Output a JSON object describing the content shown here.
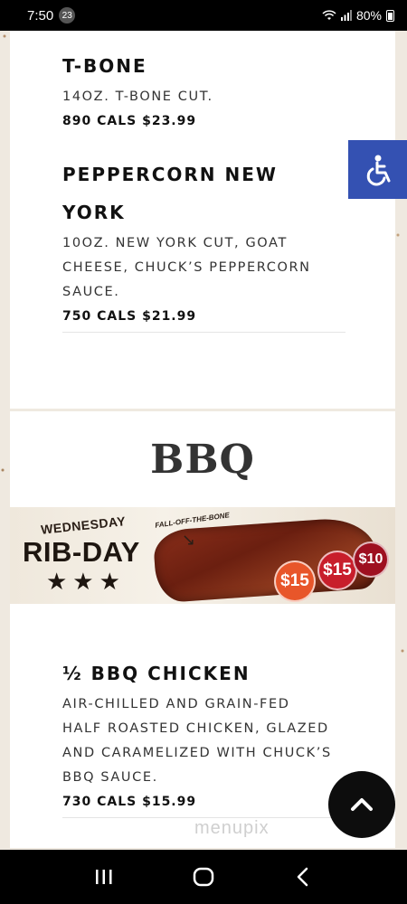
{
  "status_bar": {
    "time": "7:50",
    "notification_count": "23",
    "battery": "80%"
  },
  "menu_items_top": [
    {
      "name": "T-BONE",
      "description": "14OZ. T-BONE CUT.",
      "price": "890 CALS $23.99"
    },
    {
      "name_line1": "PEPPERCORN NEW",
      "name_line2": "YORK",
      "description_lines": [
        "10OZ. NEW YORK CUT, GOAT",
        "CHEESE, CHUCK’S PEPPERCORN",
        "SAUCE."
      ],
      "price": "750 CALS $21.99"
    }
  ],
  "section": {
    "title": "BBQ"
  },
  "banner": {
    "day": "WEDNESDAY",
    "title": "RIB-DAY",
    "stars": "★★★",
    "tagline": "FALL-OFF-THE-BONE",
    "badges": [
      "$15",
      "$15",
      "$10"
    ]
  },
  "menu_items_bottom": [
    {
      "name": "½ BBQ CHICKEN",
      "description_lines": [
        "AIR-CHILLED AND GRAIN-FED",
        "HALF ROASTED CHICKEN, GLAZED",
        "AND CARAMELIZED WITH CHUCK’S",
        "BBQ SAUCE."
      ],
      "price": "730 CALS $15.99"
    }
  ],
  "watermark": "menupix",
  "icons": {
    "accessibility": "wheelchair-icon",
    "scroll_top": "chevron-up-icon",
    "nav_recent": "recent-apps-icon",
    "nav_home": "home-icon",
    "nav_back": "back-icon"
  },
  "colors": {
    "accessibility_bg": "#3451b2",
    "scroll_top_bg": "#0d0d0d"
  }
}
